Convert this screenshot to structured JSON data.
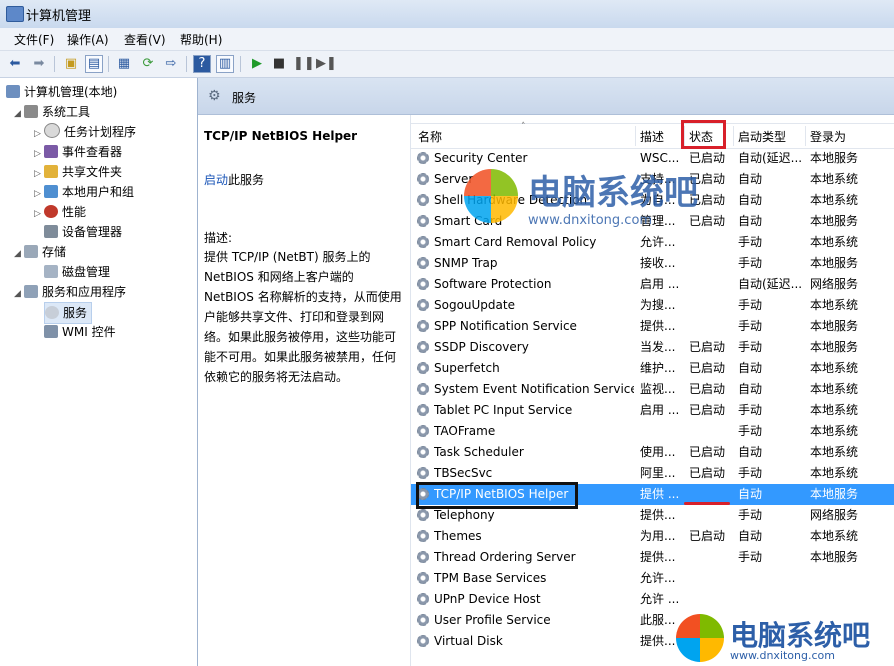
{
  "window": {
    "title": "计算机管理"
  },
  "menu": [
    "文件(F)",
    "操作(A)",
    "查看(V)",
    "帮助(H)"
  ],
  "tree": {
    "root": "计算机管理(本地)",
    "system_tools": "系统工具",
    "task_scheduler": "任务计划程序",
    "event_viewer": "事件查看器",
    "shared_folders": "共享文件夹",
    "local_users": "本地用户和组",
    "performance": "性能",
    "device_manager": "设备管理器",
    "storage": "存储",
    "disk_management": "磁盘管理",
    "services_apps": "服务和应用程序",
    "services": "服务",
    "wmi": "WMI 控件"
  },
  "header": {
    "title": "服务"
  },
  "detail": {
    "title": "TCP/IP NetBIOS Helper",
    "start_link": "启动",
    "start_suffix": "此服务",
    "desc_label": "描述:",
    "description": "提供 TCP/IP (NetBT) 服务上的 NetBIOS 和网络上客户端的 NetBIOS 名称解析的支持，从而使用户能够共享文件、打印和登录到网络。如果此服务被停用，这些功能可能不可用。如果此服务被禁用，任何依赖它的服务将无法启动。"
  },
  "columns": {
    "name": "名称",
    "desc": "描述",
    "status": "状态",
    "startup": "启动类型",
    "logon": "登录为"
  },
  "services": [
    {
      "name": "Security Center",
      "desc": "WSC...",
      "status": "已启动",
      "startup": "自动(延迟...",
      "logon": "本地服务"
    },
    {
      "name": "Server",
      "desc": "支持...",
      "status": "已启动",
      "startup": "自动",
      "logon": "本地系统"
    },
    {
      "name": "Shell Hardware Detection",
      "desc": "为自...",
      "status": "已启动",
      "startup": "自动",
      "logon": "本地系统"
    },
    {
      "name": "Smart Card",
      "desc": "管理...",
      "status": "已启动",
      "startup": "自动",
      "logon": "本地服务"
    },
    {
      "name": "Smart Card Removal Policy",
      "desc": "允许...",
      "status": "",
      "startup": "手动",
      "logon": "本地系统"
    },
    {
      "name": "SNMP Trap",
      "desc": "接收...",
      "status": "",
      "startup": "手动",
      "logon": "本地服务"
    },
    {
      "name": "Software Protection",
      "desc": "启用 ...",
      "status": "",
      "startup": "自动(延迟...",
      "logon": "网络服务"
    },
    {
      "name": "SogouUpdate",
      "desc": "为搜...",
      "status": "",
      "startup": "手动",
      "logon": "本地系统"
    },
    {
      "name": "SPP Notification Service",
      "desc": "提供...",
      "status": "",
      "startup": "手动",
      "logon": "本地服务"
    },
    {
      "name": "SSDP Discovery",
      "desc": "当发...",
      "status": "已启动",
      "startup": "手动",
      "logon": "本地服务"
    },
    {
      "name": "Superfetch",
      "desc": "维护...",
      "status": "已启动",
      "startup": "自动",
      "logon": "本地系统"
    },
    {
      "name": "System Event Notification Service",
      "desc": "监视...",
      "status": "已启动",
      "startup": "自动",
      "logon": "本地系统"
    },
    {
      "name": "Tablet PC Input Service",
      "desc": "启用 ...",
      "status": "已启动",
      "startup": "手动",
      "logon": "本地系统"
    },
    {
      "name": "TAOFrame",
      "desc": "",
      "status": "",
      "startup": "手动",
      "logon": "本地系统"
    },
    {
      "name": "Task Scheduler",
      "desc": "使用...",
      "status": "已启动",
      "startup": "自动",
      "logon": "本地系统"
    },
    {
      "name": "TBSecSvc",
      "desc": "阿里...",
      "status": "已启动",
      "startup": "手动",
      "logon": "本地系统"
    },
    {
      "name": "TCP/IP NetBIOS Helper",
      "desc": "提供 ...",
      "status": "",
      "startup": "自动",
      "logon": "本地服务"
    },
    {
      "name": "Telephony",
      "desc": "提供...",
      "status": "",
      "startup": "手动",
      "logon": "网络服务"
    },
    {
      "name": "Themes",
      "desc": "为用...",
      "status": "已启动",
      "startup": "自动",
      "logon": "本地系统"
    },
    {
      "name": "Thread Ordering Server",
      "desc": "提供...",
      "status": "",
      "startup": "手动",
      "logon": "本地服务"
    },
    {
      "name": "TPM Base Services",
      "desc": "允许...",
      "status": "",
      "startup": "",
      "logon": ""
    },
    {
      "name": "UPnP Device Host",
      "desc": "允许 ...",
      "status": "",
      "startup": "",
      "logon": ""
    },
    {
      "name": "User Profile Service",
      "desc": "此服...",
      "status": "",
      "startup": "",
      "logon": ""
    },
    {
      "name": "Virtual Disk",
      "desc": "提供...",
      "status": "",
      "startup": "",
      "logon": ""
    }
  ],
  "watermark": {
    "brand": "电脑系统吧",
    "url": "www.dnxitong.com"
  },
  "colors": {
    "selection": "#3399ff",
    "annotation_red": "#d8202a",
    "link": "#1a55b7"
  }
}
